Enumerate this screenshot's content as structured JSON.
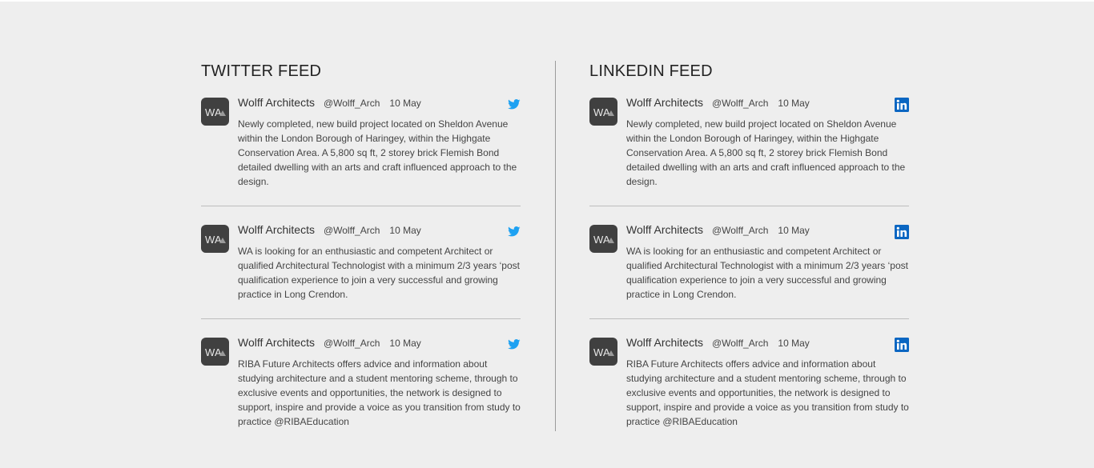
{
  "colors": {
    "background": "#eeeeee",
    "avatar": "#404040",
    "twitter_blue": "#1da1f2",
    "linkedin_blue": "#0a66c2",
    "separator": "#bdbdbd"
  },
  "twitter": {
    "title": "TWITTER FEED",
    "icon": "twitter-bird-icon",
    "posts": [
      {
        "author": "Wolff Architects",
        "handle": "@Wolff_Arch",
        "date": "10 May",
        "text": "Newly completed, new build project located on Sheldon Avenue within the London Borough of Haringey, within the Highgate Conservation Area. A 5,800 sq ft, 2 storey brick Flemish Bond detailed dwelling with an arts and craft influenced approach to the design."
      },
      {
        "author": "Wolff Architects",
        "handle": "@Wolff_Arch",
        "date": "10 May",
        "text": "WA is looking for an enthusiastic and competent Architect or qualified Architectural Technologist with a minimum 2/3 years ‘post qualification experience to join a very successful and growing practice in Long Crendon."
      },
      {
        "author": "Wolff Architects",
        "handle": "@Wolff_Arch",
        "date": "10 May",
        "text": "RIBA Future Architects offers advice and information about studying architecture and a student mentoring scheme, through to exclusive events and opportunities, the network is designed to support, inspire and provide a voice as you transition from study to practice @RIBAEducation"
      }
    ]
  },
  "linkedin": {
    "title": "LINKEDIN FEED",
    "icon": "linkedin-icon",
    "posts": [
      {
        "author": "Wolff Architects",
        "handle": "@Wolff_Arch",
        "date": "10 May",
        "text": "Newly completed, new build project located on Sheldon Avenue within the London Borough of Haringey, within the Highgate Conservation Area. A 5,800 sq ft, 2 storey brick Flemish Bond detailed dwelling with an arts and craft influenced approach to the design."
      },
      {
        "author": "Wolff Architects",
        "handle": "@Wolff_Arch",
        "date": "10 May",
        "text": "WA is looking for an enthusiastic and competent Architect or qualified Architectural Technologist with a minimum 2/3 years ‘post qualification experience to join a very successful and growing practice in Long Crendon."
      },
      {
        "author": "Wolff Architects",
        "handle": "@Wolff_Arch",
        "date": "10 May",
        "text": "RIBA Future Architects offers advice and information about studying architecture and a student mentoring scheme, through to exclusive events and opportunities, the network is designed to support, inspire and provide a voice as you transition from study to practice @RIBAEducation"
      }
    ]
  }
}
